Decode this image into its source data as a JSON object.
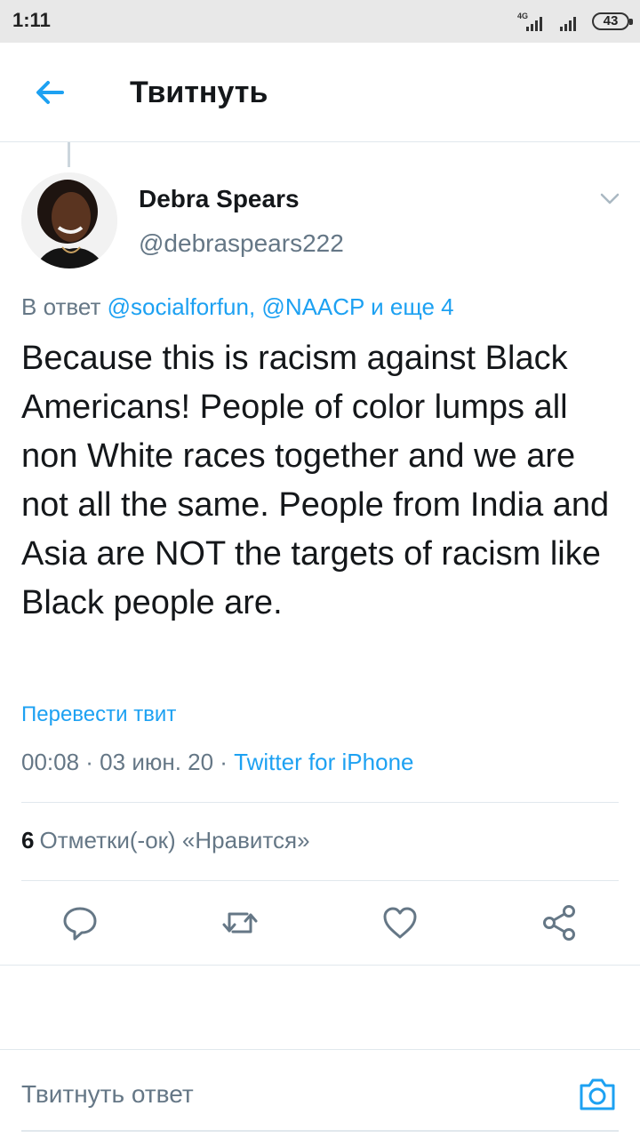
{
  "status_bar": {
    "time": "1:11",
    "battery": "43",
    "network": "4G"
  },
  "header": {
    "title": "Твитнуть",
    "back_icon": "back-arrow-icon"
  },
  "tweet": {
    "author_name": "Debra Spears",
    "author_handle": "@debraspears222",
    "reply_prefix": "В ответ",
    "reply_mentions": "@socialforfun, @NAACP и еще 4",
    "text": "Because this is racism against Black Americans! People of color lumps all non White races together and we are not all the same. People from India and Asia are NOT the targets of racism like Black people are.",
    "translate_label": "Перевести твит",
    "timestamp": "00:08 · 03 июн. 20 · ",
    "source": "Twitter for iPhone",
    "likes_count": "6",
    "likes_label": "Отметки(-ок) «Нравится»"
  },
  "actions": {
    "reply_icon": "reply-icon",
    "retweet_icon": "retweet-icon",
    "like_icon": "heart-icon",
    "share_icon": "share-icon"
  },
  "reply_bar": {
    "placeholder": "Твитнуть ответ",
    "camera_icon": "camera-icon"
  },
  "colors": {
    "accent": "#1da1f2",
    "text_primary": "#14171a",
    "text_secondary": "#657786",
    "divider": "#e1e8ed"
  }
}
